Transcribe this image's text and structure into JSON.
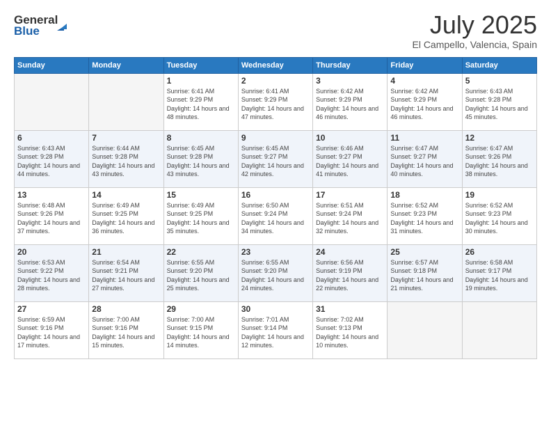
{
  "header": {
    "logo_line1": "General",
    "logo_line2": "Blue",
    "month": "July 2025",
    "location": "El Campello, Valencia, Spain"
  },
  "days_of_week": [
    "Sunday",
    "Monday",
    "Tuesday",
    "Wednesday",
    "Thursday",
    "Friday",
    "Saturday"
  ],
  "weeks": [
    [
      {
        "num": "",
        "sunrise": "",
        "sunset": "",
        "daylight": ""
      },
      {
        "num": "",
        "sunrise": "",
        "sunset": "",
        "daylight": ""
      },
      {
        "num": "1",
        "sunrise": "Sunrise: 6:41 AM",
        "sunset": "Sunset: 9:29 PM",
        "daylight": "Daylight: 14 hours and 48 minutes."
      },
      {
        "num": "2",
        "sunrise": "Sunrise: 6:41 AM",
        "sunset": "Sunset: 9:29 PM",
        "daylight": "Daylight: 14 hours and 47 minutes."
      },
      {
        "num": "3",
        "sunrise": "Sunrise: 6:42 AM",
        "sunset": "Sunset: 9:29 PM",
        "daylight": "Daylight: 14 hours and 46 minutes."
      },
      {
        "num": "4",
        "sunrise": "Sunrise: 6:42 AM",
        "sunset": "Sunset: 9:29 PM",
        "daylight": "Daylight: 14 hours and 46 minutes."
      },
      {
        "num": "5",
        "sunrise": "Sunrise: 6:43 AM",
        "sunset": "Sunset: 9:28 PM",
        "daylight": "Daylight: 14 hours and 45 minutes."
      }
    ],
    [
      {
        "num": "6",
        "sunrise": "Sunrise: 6:43 AM",
        "sunset": "Sunset: 9:28 PM",
        "daylight": "Daylight: 14 hours and 44 minutes."
      },
      {
        "num": "7",
        "sunrise": "Sunrise: 6:44 AM",
        "sunset": "Sunset: 9:28 PM",
        "daylight": "Daylight: 14 hours and 43 minutes."
      },
      {
        "num": "8",
        "sunrise": "Sunrise: 6:45 AM",
        "sunset": "Sunset: 9:28 PM",
        "daylight": "Daylight: 14 hours and 43 minutes."
      },
      {
        "num": "9",
        "sunrise": "Sunrise: 6:45 AM",
        "sunset": "Sunset: 9:27 PM",
        "daylight": "Daylight: 14 hours and 42 minutes."
      },
      {
        "num": "10",
        "sunrise": "Sunrise: 6:46 AM",
        "sunset": "Sunset: 9:27 PM",
        "daylight": "Daylight: 14 hours and 41 minutes."
      },
      {
        "num": "11",
        "sunrise": "Sunrise: 6:47 AM",
        "sunset": "Sunset: 9:27 PM",
        "daylight": "Daylight: 14 hours and 40 minutes."
      },
      {
        "num": "12",
        "sunrise": "Sunrise: 6:47 AM",
        "sunset": "Sunset: 9:26 PM",
        "daylight": "Daylight: 14 hours and 38 minutes."
      }
    ],
    [
      {
        "num": "13",
        "sunrise": "Sunrise: 6:48 AM",
        "sunset": "Sunset: 9:26 PM",
        "daylight": "Daylight: 14 hours and 37 minutes."
      },
      {
        "num": "14",
        "sunrise": "Sunrise: 6:49 AM",
        "sunset": "Sunset: 9:25 PM",
        "daylight": "Daylight: 14 hours and 36 minutes."
      },
      {
        "num": "15",
        "sunrise": "Sunrise: 6:49 AM",
        "sunset": "Sunset: 9:25 PM",
        "daylight": "Daylight: 14 hours and 35 minutes."
      },
      {
        "num": "16",
        "sunrise": "Sunrise: 6:50 AM",
        "sunset": "Sunset: 9:24 PM",
        "daylight": "Daylight: 14 hours and 34 minutes."
      },
      {
        "num": "17",
        "sunrise": "Sunrise: 6:51 AM",
        "sunset": "Sunset: 9:24 PM",
        "daylight": "Daylight: 14 hours and 32 minutes."
      },
      {
        "num": "18",
        "sunrise": "Sunrise: 6:52 AM",
        "sunset": "Sunset: 9:23 PM",
        "daylight": "Daylight: 14 hours and 31 minutes."
      },
      {
        "num": "19",
        "sunrise": "Sunrise: 6:52 AM",
        "sunset": "Sunset: 9:23 PM",
        "daylight": "Daylight: 14 hours and 30 minutes."
      }
    ],
    [
      {
        "num": "20",
        "sunrise": "Sunrise: 6:53 AM",
        "sunset": "Sunset: 9:22 PM",
        "daylight": "Daylight: 14 hours and 28 minutes."
      },
      {
        "num": "21",
        "sunrise": "Sunrise: 6:54 AM",
        "sunset": "Sunset: 9:21 PM",
        "daylight": "Daylight: 14 hours and 27 minutes."
      },
      {
        "num": "22",
        "sunrise": "Sunrise: 6:55 AM",
        "sunset": "Sunset: 9:20 PM",
        "daylight": "Daylight: 14 hours and 25 minutes."
      },
      {
        "num": "23",
        "sunrise": "Sunrise: 6:55 AM",
        "sunset": "Sunset: 9:20 PM",
        "daylight": "Daylight: 14 hours and 24 minutes."
      },
      {
        "num": "24",
        "sunrise": "Sunrise: 6:56 AM",
        "sunset": "Sunset: 9:19 PM",
        "daylight": "Daylight: 14 hours and 22 minutes."
      },
      {
        "num": "25",
        "sunrise": "Sunrise: 6:57 AM",
        "sunset": "Sunset: 9:18 PM",
        "daylight": "Daylight: 14 hours and 21 minutes."
      },
      {
        "num": "26",
        "sunrise": "Sunrise: 6:58 AM",
        "sunset": "Sunset: 9:17 PM",
        "daylight": "Daylight: 14 hours and 19 minutes."
      }
    ],
    [
      {
        "num": "27",
        "sunrise": "Sunrise: 6:59 AM",
        "sunset": "Sunset: 9:16 PM",
        "daylight": "Daylight: 14 hours and 17 minutes."
      },
      {
        "num": "28",
        "sunrise": "Sunrise: 7:00 AM",
        "sunset": "Sunset: 9:16 PM",
        "daylight": "Daylight: 14 hours and 15 minutes."
      },
      {
        "num": "29",
        "sunrise": "Sunrise: 7:00 AM",
        "sunset": "Sunset: 9:15 PM",
        "daylight": "Daylight: 14 hours and 14 minutes."
      },
      {
        "num": "30",
        "sunrise": "Sunrise: 7:01 AM",
        "sunset": "Sunset: 9:14 PM",
        "daylight": "Daylight: 14 hours and 12 minutes."
      },
      {
        "num": "31",
        "sunrise": "Sunrise: 7:02 AM",
        "sunset": "Sunset: 9:13 PM",
        "daylight": "Daylight: 14 hours and 10 minutes."
      },
      {
        "num": "",
        "sunrise": "",
        "sunset": "",
        "daylight": ""
      },
      {
        "num": "",
        "sunrise": "",
        "sunset": "",
        "daylight": ""
      }
    ]
  ]
}
